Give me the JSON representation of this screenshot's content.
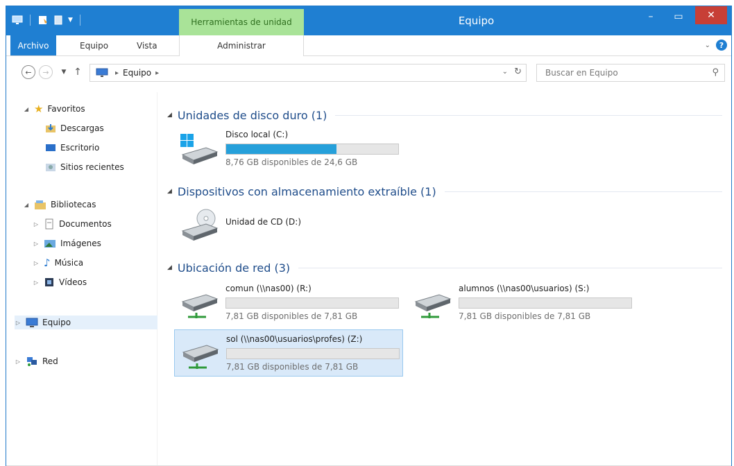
{
  "window": {
    "title": "Equipo",
    "context_tab": "Herramientas de unidad",
    "controls": {
      "minimize": "–",
      "maximize": "▭",
      "close": "✕"
    }
  },
  "ribbon": {
    "tabs": [
      {
        "label": "Archivo"
      },
      {
        "label": "Equipo"
      },
      {
        "label": "Vista"
      },
      {
        "label": "Administrar"
      }
    ],
    "help": "?"
  },
  "address": {
    "crumbs": [
      "Equipo"
    ],
    "search_placeholder": "Buscar en Equipo"
  },
  "nav": {
    "favoritos": {
      "label": "Favoritos",
      "items": [
        "Descargas",
        "Escritorio",
        "Sitios recientes"
      ]
    },
    "bibliotecas": {
      "label": "Bibliotecas",
      "items": [
        "Documentos",
        "Imágenes",
        "Música",
        "Vídeos"
      ]
    },
    "equipo": "Equipo",
    "red": "Red"
  },
  "groups": {
    "hdd": {
      "title": "Unidades de disco duro (1)",
      "drives": [
        {
          "name": "Disco local (C:)",
          "free": "8,76 GB disponibles de 24,6 GB",
          "used_fraction": 0.64
        }
      ]
    },
    "removable": {
      "title": "Dispositivos con almacenamiento extraíble (1)",
      "drives": [
        {
          "name": "Unidad de CD (D:)"
        }
      ]
    },
    "network": {
      "title": "Ubicación de red (3)",
      "drives": [
        {
          "name": "comun (\\\\nas00) (R:)",
          "free": "7,81 GB disponibles de 7,81 GB",
          "used_fraction": 0
        },
        {
          "name": "alumnos (\\\\nas00\\usuarios) (S:)",
          "free": "7,81 GB disponibles de 7,81 GB",
          "used_fraction": 0
        },
        {
          "name": "sol (\\\\nas00\\usuarios\\profes) (Z:)",
          "free": "7,81 GB disponibles de 7,81 GB",
          "used_fraction": 0
        }
      ]
    }
  },
  "colors": {
    "titlebar": "#1f7fd2",
    "context_tab": "#a9e398",
    "close": "#c73f36",
    "bar_fill": "#26a0da",
    "group_title": "#1e4c8a"
  }
}
